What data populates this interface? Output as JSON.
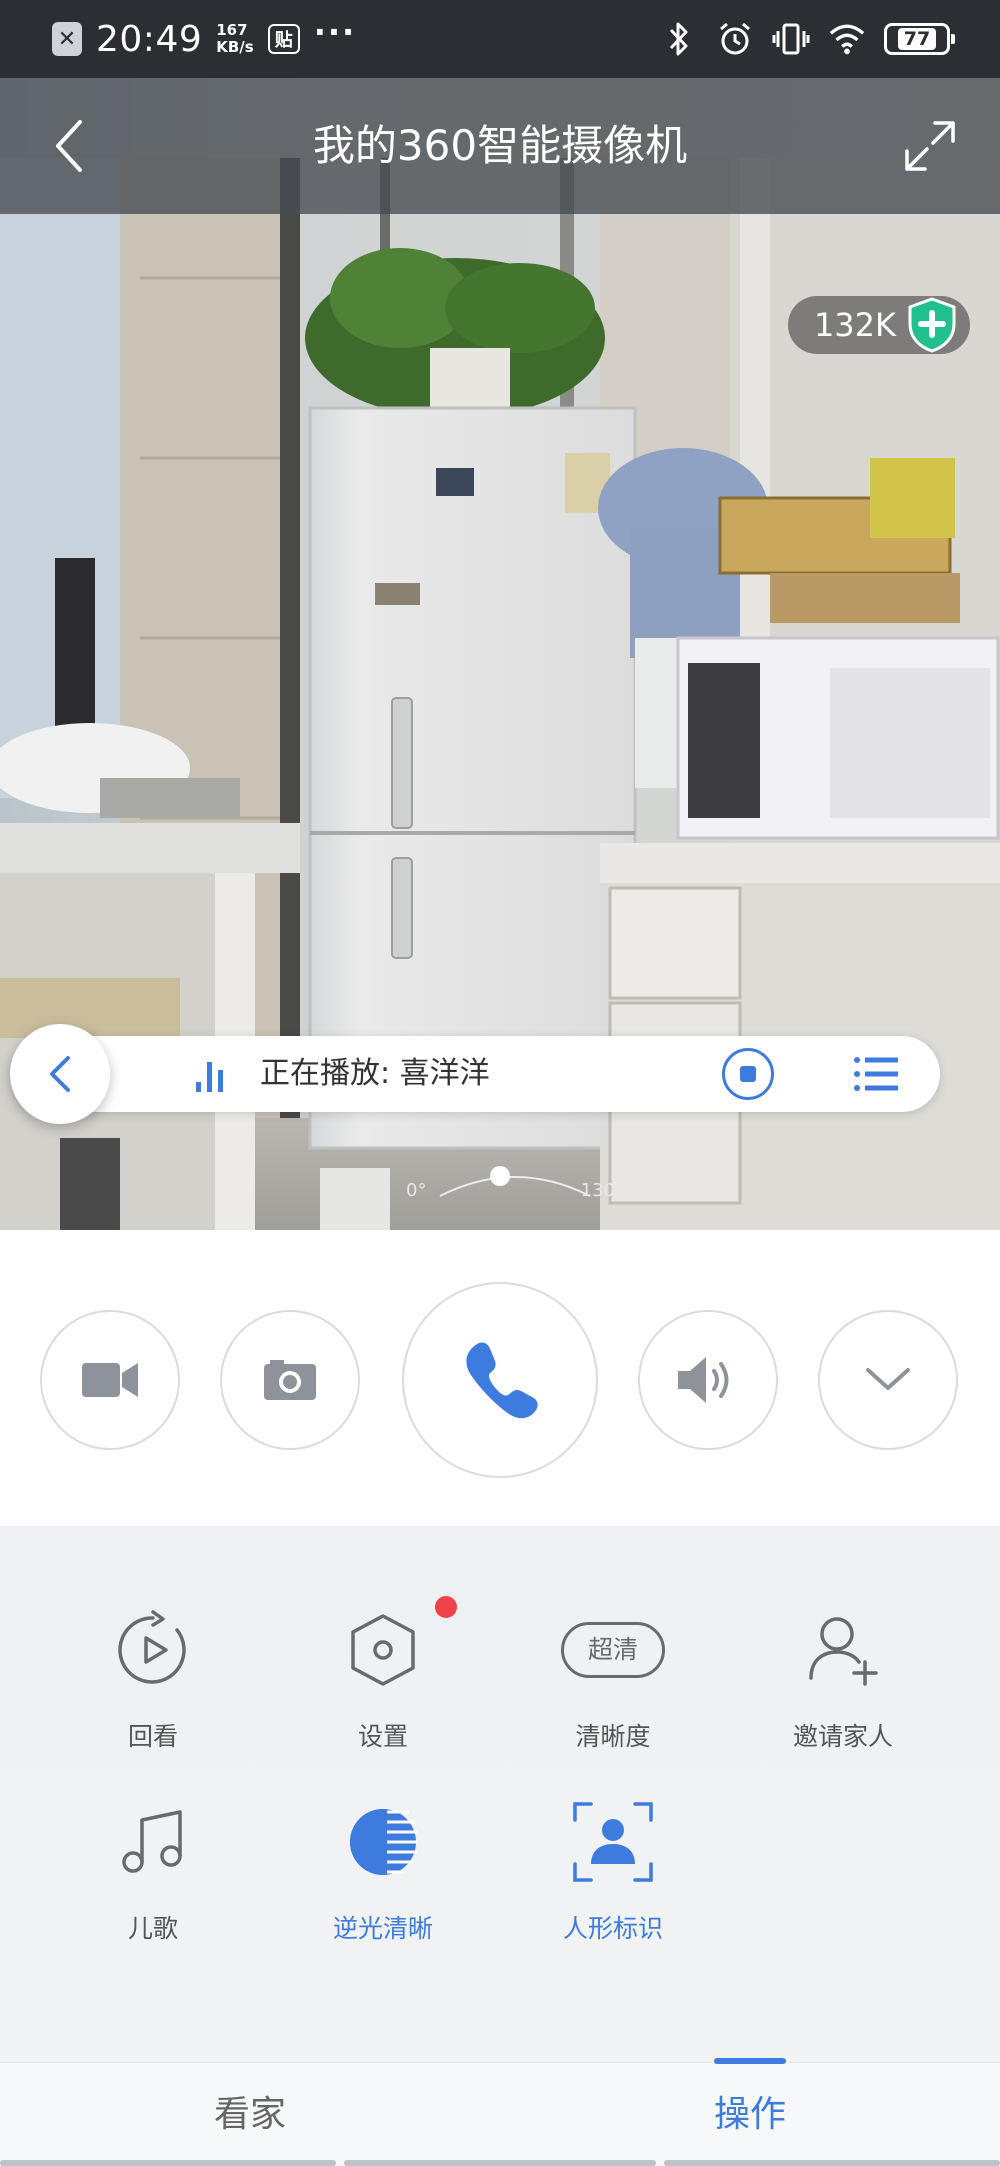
{
  "status_bar": {
    "notification_icon": "close-box-icon",
    "time": "20:49",
    "speed_value": "167",
    "speed_unit": "KB/s",
    "app_badge": "贴",
    "more": "···",
    "icons": [
      "bluetooth-icon",
      "alarm-icon",
      "vibrate-icon",
      "wifi-icon",
      "battery-icon"
    ],
    "battery": "77"
  },
  "header": {
    "title": "我的360智能摄像机",
    "back_icon": "chevron-left-icon",
    "fullscreen_icon": "expand-icon"
  },
  "feed": {
    "bitrate": "132K",
    "shield_icon": "shield-plus-icon",
    "player": {
      "now_playing": "正在播放: 喜洋洋",
      "back_icon": "chevron-left-icon",
      "bars_icon": "audio-bars-icon",
      "stop_icon": "stop-circle-icon",
      "list_icon": "list-icon"
    },
    "angle": {
      "min": "0°",
      "max": "130°"
    }
  },
  "controls": [
    {
      "id": "record",
      "icon": "video-camera-icon"
    },
    {
      "id": "snapshot",
      "icon": "camera-icon"
    },
    {
      "id": "call",
      "icon": "phone-icon"
    },
    {
      "id": "sound",
      "icon": "speaker-icon"
    },
    {
      "id": "more",
      "icon": "chevron-down-icon"
    }
  ],
  "features": {
    "playback": {
      "label": "回看",
      "icon": "replay-icon"
    },
    "settings": {
      "label": "设置",
      "icon": "hexagon-settings-icon",
      "has_badge": true
    },
    "quality": {
      "label": "清晰度",
      "icon": "hd-badge-icon",
      "badge_text": "超清"
    },
    "invite": {
      "label": "邀请家人",
      "icon": "add-user-icon"
    },
    "songs": {
      "label": "儿歌",
      "icon": "music-note-icon"
    },
    "backlight": {
      "label": "逆光清晰",
      "icon": "backlight-icon",
      "active": true
    },
    "person": {
      "label": "人形标识",
      "icon": "person-frame-icon",
      "active": true
    }
  },
  "tabs": {
    "home": "看家",
    "operate": "操作",
    "active": "operate"
  },
  "colors": {
    "accent": "#3e7bdf",
    "status_bar": "#2b2e33",
    "badge_red": "#f0424a",
    "shield_green": "#21c18e"
  }
}
